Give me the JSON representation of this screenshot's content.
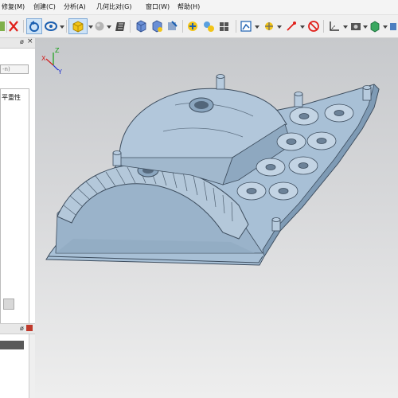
{
  "menu": {
    "items": [
      {
        "label": "修复(M)"
      },
      {
        "label": "创建(C)"
      },
      {
        "label": "分析(A)"
      },
      {
        "label": "几何比对(G)"
      },
      {
        "label": "窗口(W)"
      },
      {
        "label": "帮助(H)"
      }
    ]
  },
  "left_panel": {
    "pin_glyph": "ø",
    "close_glyph": "×",
    "dropdown_value": "-n)",
    "list_item": "平重性",
    "bottom_pin_glyph": "ø"
  },
  "axis": {
    "x": "X",
    "y": "Y",
    "z": "Z"
  },
  "colors": {
    "model": "#a8c0d6",
    "model_shade": "#7f9bb5",
    "edge": "#3d4d5e",
    "close_red": "#e0201a",
    "viewport_top": "#c7c9cc",
    "viewport_bottom": "#eeeeee"
  },
  "toolbar_icons": [
    "save-icon",
    "close-icon",
    "rotate-view-icon",
    "orbit-icon",
    "shaded-cube-icon",
    "sphere-icon",
    "clipboard-icon",
    "view-cube-icon",
    "view-cube-alt-icon",
    "link-icon",
    "measure-icon",
    "multi-view-icon",
    "analysis-icon",
    "transform-icon",
    "point-icon",
    "no-entry-icon",
    "axis-icon",
    "camera-icon",
    "green-cube-icon"
  ]
}
